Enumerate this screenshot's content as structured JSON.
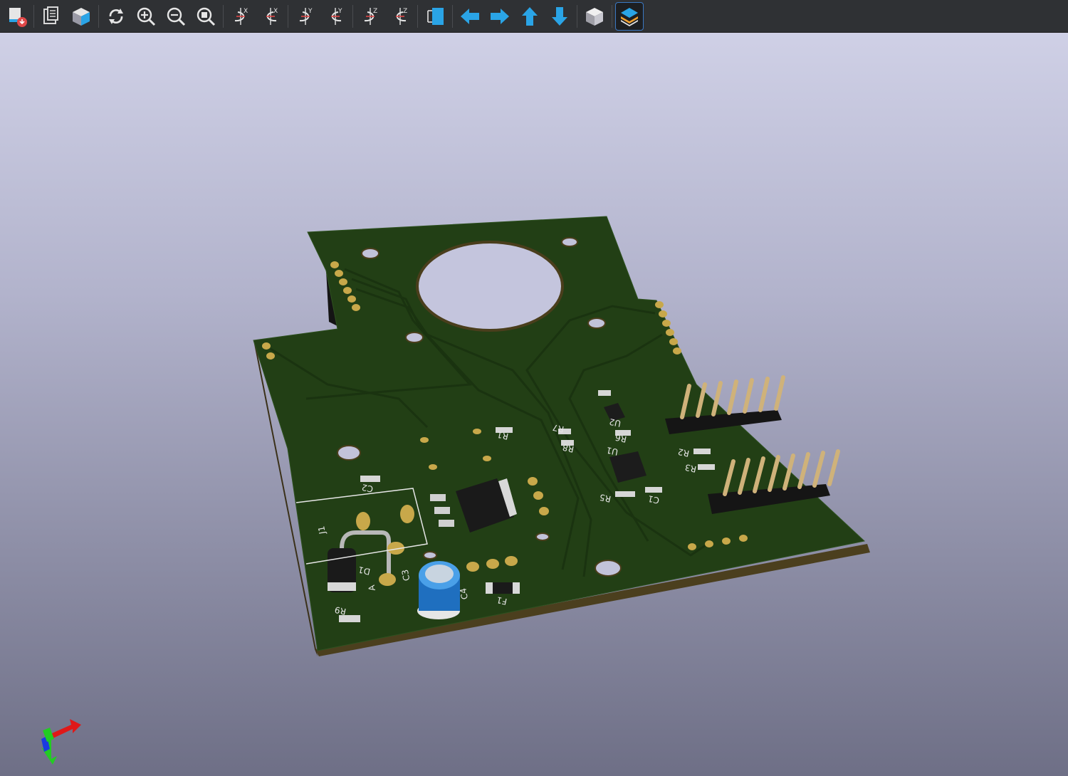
{
  "toolbar": {
    "buttons": [
      {
        "name": "reload-board-button",
        "icon": "reload-board-icon"
      },
      {
        "name": "copy-image-button",
        "icon": "copy-icon"
      },
      {
        "name": "raytrace-button",
        "icon": "raytrace-cube-icon"
      },
      {
        "name": "refresh-button",
        "icon": "refresh-icon"
      },
      {
        "name": "zoom-in-button",
        "icon": "zoom-in-icon"
      },
      {
        "name": "zoom-out-button",
        "icon": "zoom-out-icon"
      },
      {
        "name": "zoom-fit-button",
        "icon": "zoom-fit-icon"
      },
      {
        "name": "rotate-x-cw-button",
        "icon": "rotate-x-cw-icon",
        "label": "X"
      },
      {
        "name": "rotate-x-ccw-button",
        "icon": "rotate-x-ccw-icon",
        "label": "X"
      },
      {
        "name": "rotate-y-cw-button",
        "icon": "rotate-y-cw-icon",
        "label": "Y"
      },
      {
        "name": "rotate-y-ccw-button",
        "icon": "rotate-y-ccw-icon",
        "label": "Y"
      },
      {
        "name": "rotate-z-cw-button",
        "icon": "rotate-z-cw-icon",
        "label": "Z"
      },
      {
        "name": "rotate-z-ccw-button",
        "icon": "rotate-z-ccw-icon",
        "label": "Z"
      },
      {
        "name": "flip-board-button",
        "icon": "flip-board-icon"
      },
      {
        "name": "move-left-button",
        "icon": "arrow-left-icon"
      },
      {
        "name": "move-right-button",
        "icon": "arrow-right-icon"
      },
      {
        "name": "move-up-button",
        "icon": "arrow-up-icon"
      },
      {
        "name": "move-down-button",
        "icon": "arrow-down-icon"
      },
      {
        "name": "ortho-view-button",
        "icon": "ortho-cube-icon"
      },
      {
        "name": "layers-button",
        "icon": "layers-icon",
        "active": true
      }
    ]
  },
  "board": {
    "labels": {
      "r1": "R1",
      "r2": "R2",
      "r3": "R3",
      "r5": "R5",
      "r6": "R6",
      "r7": "R7",
      "r8": "R8",
      "r9": "R9",
      "c1": "C1",
      "c2": "C2",
      "c3": "C3",
      "c4": "C4",
      "u2": "U2",
      "u1": "U1",
      "j1": "J1",
      "d1": "D1",
      "a": "A",
      "f1": "F1"
    }
  },
  "colors": {
    "board": "#1f3b14",
    "board_edge": "#4a3e1c",
    "copper": "#c8a84a",
    "silk": "#e6e6e6",
    "accent_blue": "#2aa4e6"
  }
}
